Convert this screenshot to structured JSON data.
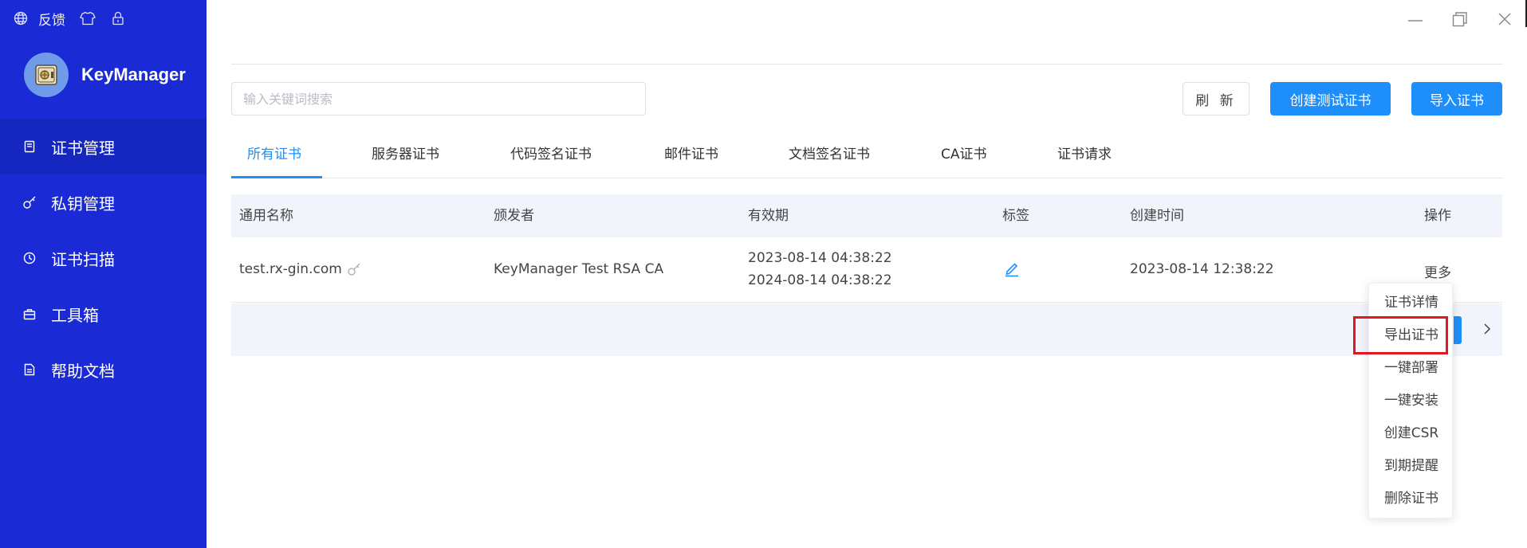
{
  "topbar": {
    "feedback_label": "反馈"
  },
  "brand": {
    "name": "KeyManager"
  },
  "sidebar": {
    "items": [
      {
        "label": "证书管理",
        "icon": "certificate-icon",
        "active": true
      },
      {
        "label": "私钥管理",
        "icon": "key-icon",
        "active": false
      },
      {
        "label": "证书扫描",
        "icon": "scan-icon",
        "active": false
      },
      {
        "label": "工具箱",
        "icon": "toolbox-icon",
        "active": false
      },
      {
        "label": "帮助文档",
        "icon": "document-icon",
        "active": false
      }
    ]
  },
  "toolbar": {
    "search_placeholder": "输入关键词搜索",
    "refresh_label": "刷 新",
    "create_test_label": "创建测试证书",
    "import_label": "导入证书"
  },
  "tabs": [
    {
      "label": "所有证书",
      "active": true
    },
    {
      "label": "服务器证书",
      "active": false
    },
    {
      "label": "代码签名证书",
      "active": false
    },
    {
      "label": "邮件证书",
      "active": false
    },
    {
      "label": "文档签名证书",
      "active": false
    },
    {
      "label": "CA证书",
      "active": false
    },
    {
      "label": "证书请求",
      "active": false
    }
  ],
  "table": {
    "headers": [
      "通用名称",
      "颁发者",
      "有效期",
      "标签",
      "创建时间",
      "操作"
    ],
    "rows": [
      {
        "name": "test.rx-gin.com",
        "issuer": "KeyManager Test RSA CA",
        "valid_from": "2023-08-14 04:38:22",
        "valid_to": "2024-08-14 04:38:22",
        "created": "2023-08-14 12:38:22",
        "action": "更多"
      }
    ]
  },
  "dropdown": {
    "items": [
      "证书详情",
      "导出证书",
      "一键部署",
      "一键安装",
      "创建CSR",
      "到期提醒",
      "删除证书"
    ],
    "highlighted": "导出证书"
  },
  "colors": {
    "sidebar": "#1a2bd6",
    "sidebar_active": "#1627bf",
    "accent": "#1e8efb",
    "highlight_box": "#e3161e"
  }
}
